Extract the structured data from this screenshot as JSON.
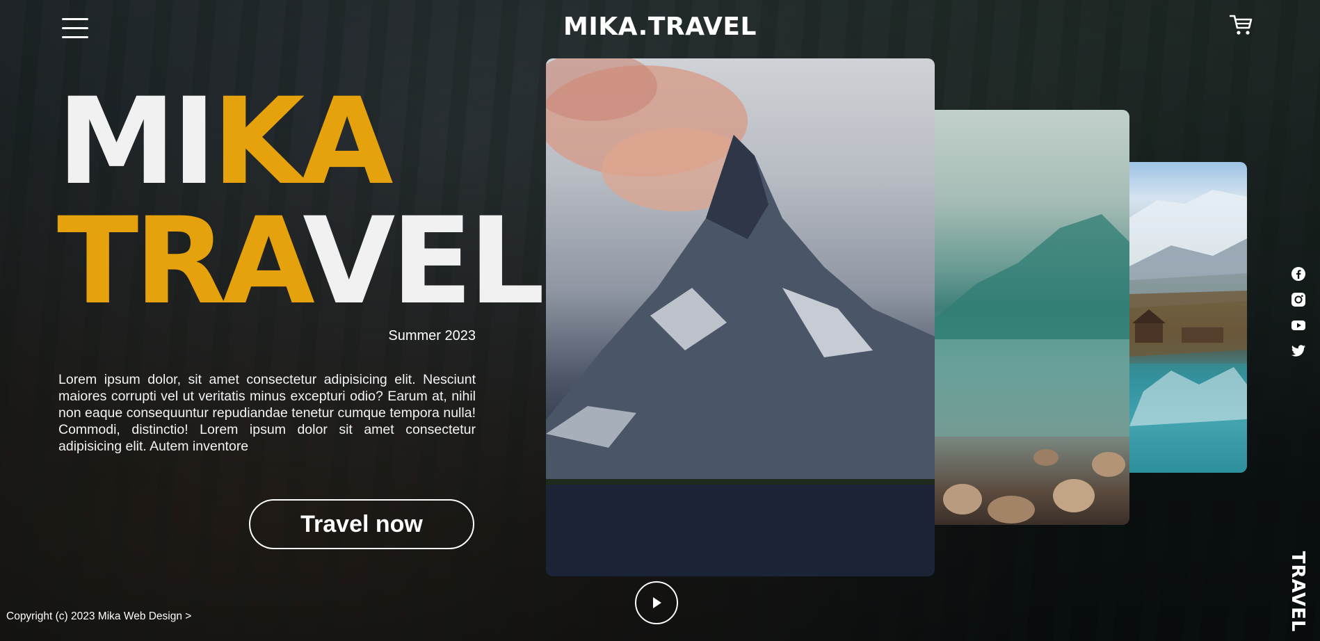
{
  "header": {
    "logo": "MIKA.TRAVEL",
    "menu_icon": "hamburger-menu-icon",
    "cart_icon": "shopping-cart-icon"
  },
  "hero": {
    "title_line1_white": "MI",
    "title_line1_yellow": "KA",
    "title_line2_yellow": "TRA",
    "title_line2_white": "VEL",
    "season": "Summer 2023",
    "description": "Lorem ipsum dolor, sit amet consectetur adipisicing elit. Nesciunt maiores corrupti vel ut veritatis minus excepturi odio? Earum at, nihil non eaque consequuntur repudiandae tenetur cumque tempora nulla! Commodi, distinctio! Lorem ipsum dolor sit amet consectetur adipisicing elit. Autem inventore",
    "cta_label": "Travel now"
  },
  "gallery": {
    "cards": [
      {
        "name": "mountain-peak-photo"
      },
      {
        "name": "mountain-lake-photo"
      },
      {
        "name": "alpine-village-photo"
      }
    ],
    "play_icon": "play-icon"
  },
  "social": [
    "facebook-icon",
    "instagram-icon",
    "youtube-icon",
    "twitter-icon"
  ],
  "side_label": "TRAVEL",
  "footer": {
    "copyright": "Copyright (c) 2023 Mika Web Design >"
  },
  "colors": {
    "accent": "#e6a20c",
    "text": "#f1f1f1",
    "background": "#0d1214"
  }
}
